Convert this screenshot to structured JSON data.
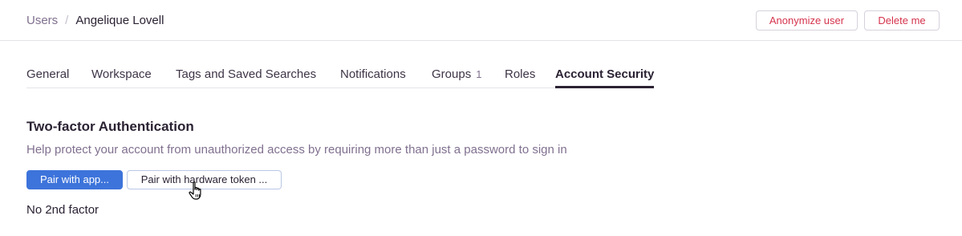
{
  "breadcrumb": {
    "root": "Users",
    "separator": "/",
    "current": "Angelique Lovell"
  },
  "header_actions": {
    "anonymize_label": "Anonymize user",
    "delete_label": "Delete me"
  },
  "tabs": [
    {
      "label": "General",
      "active": false
    },
    {
      "label": "Workspace",
      "active": false
    },
    {
      "label": "Tags and Saved Searches",
      "active": false
    },
    {
      "label": "Notifications",
      "active": false
    },
    {
      "label": "Groups",
      "count": "1",
      "active": false
    },
    {
      "label": "Roles",
      "active": false
    },
    {
      "label": "Account Security",
      "active": true
    }
  ],
  "two_factor": {
    "title": "Two-factor Authentication",
    "description": "Help protect your account from unauthorized access by requiring more than just a password to sign in",
    "pair_app_label": "Pair with app...",
    "pair_token_label": "Pair with hardware token ...",
    "status": "No 2nd factor"
  },
  "colors": {
    "primary": "#3d74db",
    "danger": "#d5334d",
    "muted": "#80708f",
    "text": "#2b2233"
  },
  "icons": {
    "cursor": "hand-pointer-icon"
  }
}
